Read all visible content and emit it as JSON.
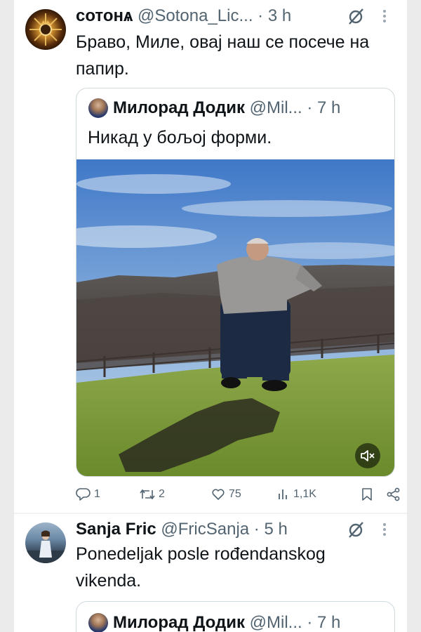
{
  "tweets": [
    {
      "author_name": "сотонѧ",
      "handle": "@Sotona_Lic...",
      "dot": "·",
      "time": "3 h",
      "text": "Браво, Миле, овај наш се посече на папир.",
      "quote": {
        "author_name": "Милорад Додик",
        "handle": "@Mil...",
        "dot": "·",
        "time": "7 h",
        "text": "Никад у бољој форми."
      },
      "actions": {
        "replies": "1",
        "retweets": "2",
        "likes": "75",
        "views": "1,1K"
      }
    },
    {
      "author_name": "Sanja Fric",
      "handle": "@FricSanja",
      "dot": "·",
      "time": "5 h",
      "text": "Ponedeljak posle rođendanskog vikenda.",
      "quote": {
        "author_name": "Милорад Додик",
        "handle": "@Mil...",
        "dot": "·",
        "time": "7 h"
      }
    }
  ],
  "icons": {
    "grok": "grok-icon",
    "more": "more-vertical-icon",
    "reply": "reply-icon",
    "retweet": "retweet-icon",
    "like": "heart-icon",
    "views": "views-chart-icon",
    "bookmark": "bookmark-icon",
    "share": "share-icon",
    "mute": "volume-muted-icon"
  },
  "colors": {
    "text": "#0f1419",
    "secondary": "#536471",
    "border": "#cfd9de",
    "background": "#ffffff"
  }
}
